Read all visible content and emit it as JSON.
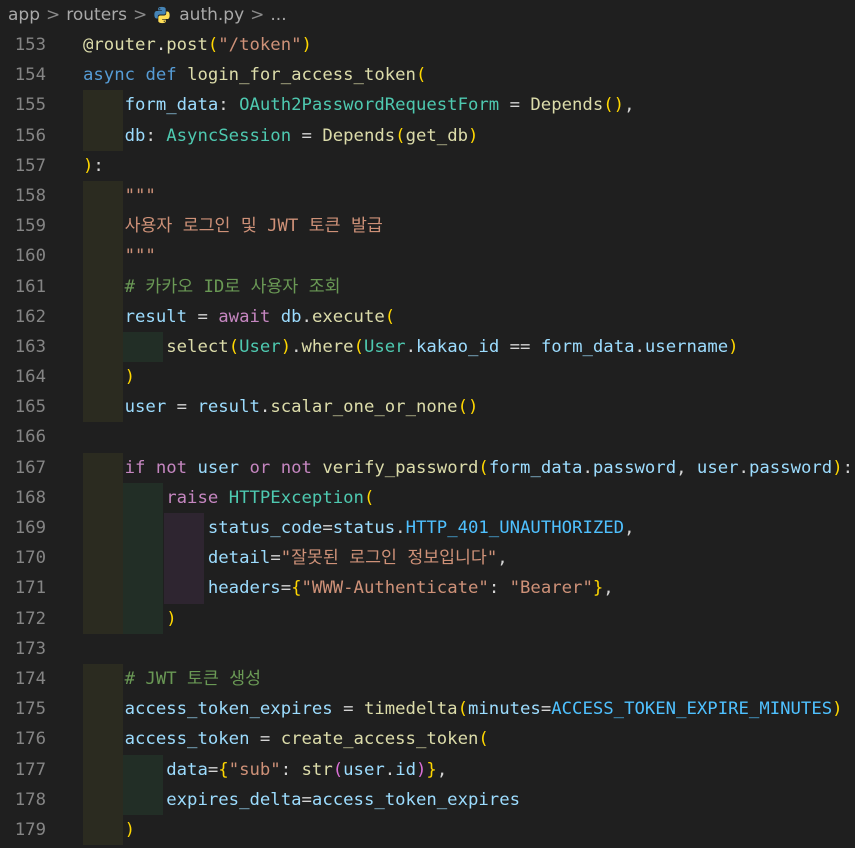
{
  "breadcrumb": {
    "items": [
      "app",
      "routers",
      "auth.py",
      "..."
    ],
    "separator": ">"
  },
  "colors": {
    "background": "#1f1f1f",
    "line_number": "#858585",
    "keyword": "#569cd6",
    "control": "#c586c0",
    "function": "#dcdcaa",
    "class": "#4ec9b0",
    "variable": "#9cdcfe",
    "string": "#ce9178",
    "comment": "#6a9955"
  },
  "editor": {
    "lines": [
      {
        "n": "153",
        "t": "@router.post(\"/token\")"
      },
      {
        "n": "154",
        "t": "async def login_for_access_token("
      },
      {
        "n": "155",
        "t": "    form_data: OAuth2PasswordRequestForm = Depends(),"
      },
      {
        "n": "156",
        "t": "    db: AsyncSession = Depends(get_db)"
      },
      {
        "n": "157",
        "t": "):"
      },
      {
        "n": "158",
        "t": "    \"\"\""
      },
      {
        "n": "159",
        "t": "    사용자 로그인 및 JWT 토큰 발급"
      },
      {
        "n": "160",
        "t": "    \"\"\""
      },
      {
        "n": "161",
        "t": "    # 카카오 ID로 사용자 조회"
      },
      {
        "n": "162",
        "t": "    result = await db.execute("
      },
      {
        "n": "163",
        "t": "        select(User).where(User.kakao_id == form_data.username)"
      },
      {
        "n": "164",
        "t": "    )"
      },
      {
        "n": "165",
        "t": "    user = result.scalar_one_or_none()"
      },
      {
        "n": "166",
        "t": ""
      },
      {
        "n": "167",
        "t": "    if not user or not verify_password(form_data.password, user.password):"
      },
      {
        "n": "168",
        "t": "        raise HTTPException("
      },
      {
        "n": "169",
        "t": "            status_code=status.HTTP_401_UNAUTHORIZED,"
      },
      {
        "n": "170",
        "t": "            detail=\"잘못된 로그인 정보입니다\","
      },
      {
        "n": "171",
        "t": "            headers={\"WWW-Authenticate\": \"Bearer\"},"
      },
      {
        "n": "172",
        "t": "        )"
      },
      {
        "n": "173",
        "t": ""
      },
      {
        "n": "174",
        "t": "    # JWT 토큰 생성"
      },
      {
        "n": "175",
        "t": "    access_token_expires = timedelta(minutes=ACCESS_TOKEN_EXPIRE_MINUTES)"
      },
      {
        "n": "176",
        "t": "    access_token = create_access_token("
      },
      {
        "n": "177",
        "t": "        data={\"sub\": str(user.id)},"
      },
      {
        "n": "178",
        "t": "        expires_delta=access_token_expires"
      },
      {
        "n": "179",
        "t": "    )"
      }
    ]
  }
}
